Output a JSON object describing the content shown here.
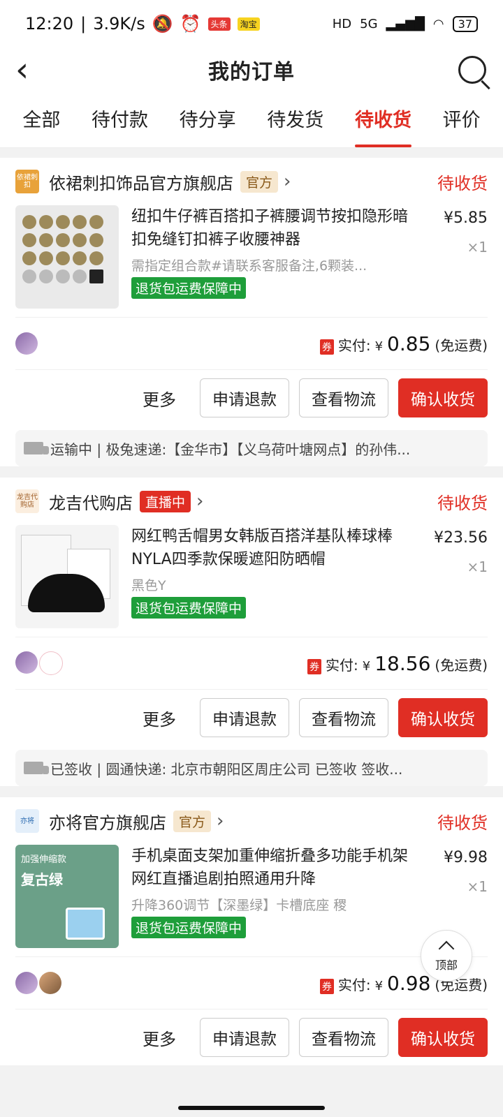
{
  "status_bar": {
    "time": "12:20",
    "net_speed": "3.9K/s",
    "tag1": "头条",
    "tag2": "淘宝",
    "hd": "HD",
    "signal": "5G",
    "battery": "37"
  },
  "nav": {
    "title": "我的订单"
  },
  "tabs": [
    "全部",
    "待付款",
    "待分享",
    "待发货",
    "待收货",
    "评价"
  ],
  "orders": [
    {
      "shop": "依裙刺扣饰品官方旗舰店",
      "shop_logo": "依裙刺扣",
      "badge": "官方",
      "status": "待收货",
      "title": "纽扣牛仔裤百搭扣子裤腰调节按扣隐形暗扣免缝钉扣裤子收腰神器",
      "spec": "需指定组合款#请联系客服备注,6颗装...",
      "guarantee": "退货包运费保障中",
      "price": "¥5.85",
      "qty": "×1",
      "coupon": "券",
      "pay_label": "实付:",
      "yen": "¥",
      "pay_amount": "0.85",
      "ship": "(免运费)",
      "more": "更多",
      "btn_refund": "申请退款",
      "btn_logistics": "查看物流",
      "btn_confirm": "确认收货",
      "logistics": "运输中 | 极兔速递:【金华市】【义乌荷叶塘网点】的孙伟..."
    },
    {
      "shop": "龙吉代购店",
      "shop_logo": "龙吉代购店",
      "badge": "直播中",
      "status": "待收货",
      "title": "网红鸭舌帽男女韩版百搭洋基队棒球棒NYLA四季款保暖遮阳防晒帽",
      "spec": "黑色Y",
      "guarantee": "退货包运费保障中",
      "price": "¥23.56",
      "qty": "×1",
      "coupon": "券",
      "pay_label": "实付:",
      "yen": "¥",
      "pay_amount": "18.56",
      "ship": "(免运费)",
      "more": "更多",
      "btn_refund": "申请退款",
      "btn_logistics": "查看物流",
      "btn_confirm": "确认收货",
      "logistics": "已签收 | 圆通快递: 北京市朝阳区周庄公司 已签收  签收..."
    },
    {
      "shop": "亦将官方旗舰店",
      "shop_logo": "亦将",
      "badge": "官方",
      "status": "待收货",
      "title": "手机桌面支架加重伸缩折叠多功能手机架网红直播追剧拍照通用升降",
      "spec": "升降360调节【深墨绿】卡槽底座 稷",
      "guarantee": "退货包运费保障中",
      "price": "¥9.98",
      "qty": "×1",
      "coupon": "券",
      "pay_label": "实付:",
      "yen": "¥",
      "pay_amount": "0.98",
      "ship": "(免运费)",
      "more": "更多",
      "btn_refund": "申请退款",
      "btn_logistics": "查看物流",
      "btn_confirm": "确认收货",
      "img_tag": "加强伸缩款",
      "img_title": "复古绿"
    }
  ],
  "top_button": "顶部",
  "colors": {
    "accent": "#e02e24",
    "guarantee": "#1e9e3a",
    "official_badge": "#f6e7cf"
  }
}
